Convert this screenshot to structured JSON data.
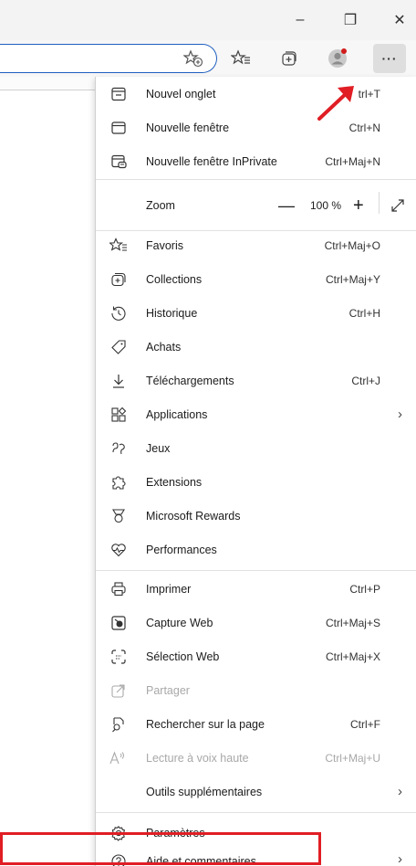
{
  "window": {
    "minimize_glyph": "–",
    "restore_glyph": "❐",
    "close_glyph": "✕"
  },
  "toolbar": {
    "more_glyph": "···"
  },
  "menu": {
    "new_tab": {
      "label": "Nouvel onglet",
      "shortcut": "trl+T"
    },
    "new_window": {
      "label": "Nouvelle fenêtre",
      "shortcut": "Ctrl+N"
    },
    "inprivate": {
      "label": "Nouvelle fenêtre InPrivate",
      "shortcut": "Ctrl+Maj+N"
    },
    "zoom": {
      "label": "Zoom",
      "minus": "—",
      "value": "100 %",
      "plus": "+"
    },
    "favorites": {
      "label": "Favoris",
      "shortcut": "Ctrl+Maj+O"
    },
    "collections": {
      "label": "Collections",
      "shortcut": "Ctrl+Maj+Y"
    },
    "history": {
      "label": "Historique",
      "shortcut": "Ctrl+H"
    },
    "shopping": {
      "label": "Achats"
    },
    "downloads": {
      "label": "Téléchargements",
      "shortcut": "Ctrl+J"
    },
    "apps": {
      "label": "Applications",
      "chevron": "›"
    },
    "games": {
      "label": "Jeux"
    },
    "extensions": {
      "label": "Extensions"
    },
    "rewards": {
      "label": "Microsoft Rewards"
    },
    "performance": {
      "label": "Performances"
    },
    "print": {
      "label": "Imprimer",
      "shortcut": "Ctrl+P"
    },
    "web_capture": {
      "label": "Capture Web",
      "shortcut": "Ctrl+Maj+S"
    },
    "web_select": {
      "label": "Sélection Web",
      "shortcut": "Ctrl+Maj+X"
    },
    "share": {
      "label": "Partager"
    },
    "find": {
      "label": "Rechercher sur la page",
      "shortcut": "Ctrl+F"
    },
    "read_aloud": {
      "label": "Lecture à voix haute",
      "shortcut": "Ctrl+Maj+U"
    },
    "more_tools": {
      "label": "Outils supplémentaires",
      "chevron": "›"
    },
    "settings": {
      "label": "Paramètres"
    },
    "help": {
      "label": "Aide et commentaires",
      "chevron": "›"
    }
  },
  "colors": {
    "annotation_red": "#e01e24",
    "address_border": "#1f5fbf",
    "notification_dot": "#d11b1b"
  }
}
